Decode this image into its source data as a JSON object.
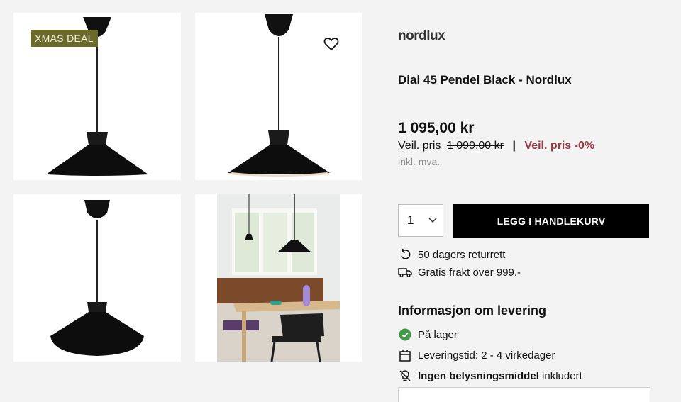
{
  "badge": {
    "text": "XMAS DEAL"
  },
  "product": {
    "brand": "nordlux",
    "title": "Dial 45 Pendel Black - Nordlux",
    "price": "1 095,00 kr",
    "veil_label": "Veil. pris",
    "veil_old_price": "1 099,00 kr",
    "separator": "|",
    "veil_discount": "Veil. pris -0%",
    "vat_note": "inkl. mva."
  },
  "purchase": {
    "quantity": "1",
    "add_to_cart_label": "LEGG I HANDLEKURV"
  },
  "perks": [
    {
      "icon": "return-arrow-icon",
      "text": "50 dagers returrett"
    },
    {
      "icon": "truck-icon",
      "text": "Gratis frakt over 999.-"
    }
  ],
  "delivery": {
    "heading": "Informasjon om levering",
    "stock": {
      "icon": "check-circle-icon",
      "text": "På lager",
      "color": "#3f9b48"
    },
    "lead_time": {
      "icon": "calendar-icon",
      "text": "Leveringstid: 2 - 4 virkedager"
    },
    "bulb": {
      "icon": "no-bulb-icon",
      "bold": "Ingen belysningsmiddel",
      "rest": " inkludert"
    }
  },
  "colors": {
    "badge_bg": "#6b6a2b",
    "discount": "#9c3a45",
    "cart_bg": "#000000"
  }
}
